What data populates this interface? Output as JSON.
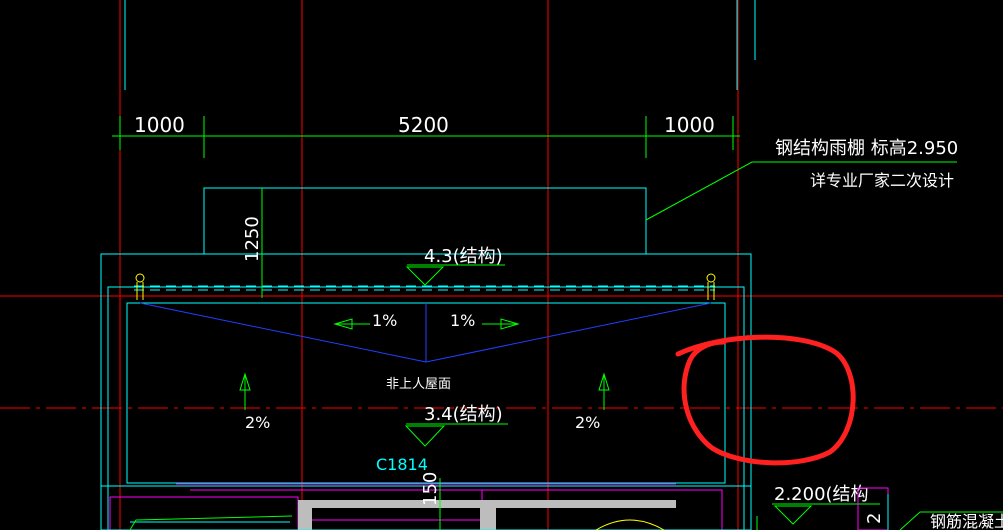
{
  "dimensions": {
    "left": "1000",
    "middle": "5200",
    "right": "1000",
    "vertical_height": "1250",
    "bottom_vertical": "150",
    "bottom_right_partial": "2"
  },
  "callout": {
    "line1": "钢结构雨棚 标高2.950",
    "line2": "详专业厂家二次设计"
  },
  "elevations": {
    "top": "4.3(结构)",
    "mid": "3.4(结构)",
    "right": "2.200(结构"
  },
  "roof": {
    "label": "非上人屋面",
    "slope_left": "1%",
    "slope_right": "1%",
    "slope_down_left": "2%",
    "slope_down_right": "2%"
  },
  "window_tag": "C1814",
  "corner_text": "钢筋混凝土",
  "colors": {
    "background": "#000000",
    "axis": "#ff0000",
    "grid_line": "#ff0000",
    "outline": "#00ffff",
    "slope": "#0000ff",
    "arrow": "#00ff00",
    "annotation": "#ff00ff",
    "text": "#ffffff",
    "highlight_circle": "#ff2020"
  }
}
